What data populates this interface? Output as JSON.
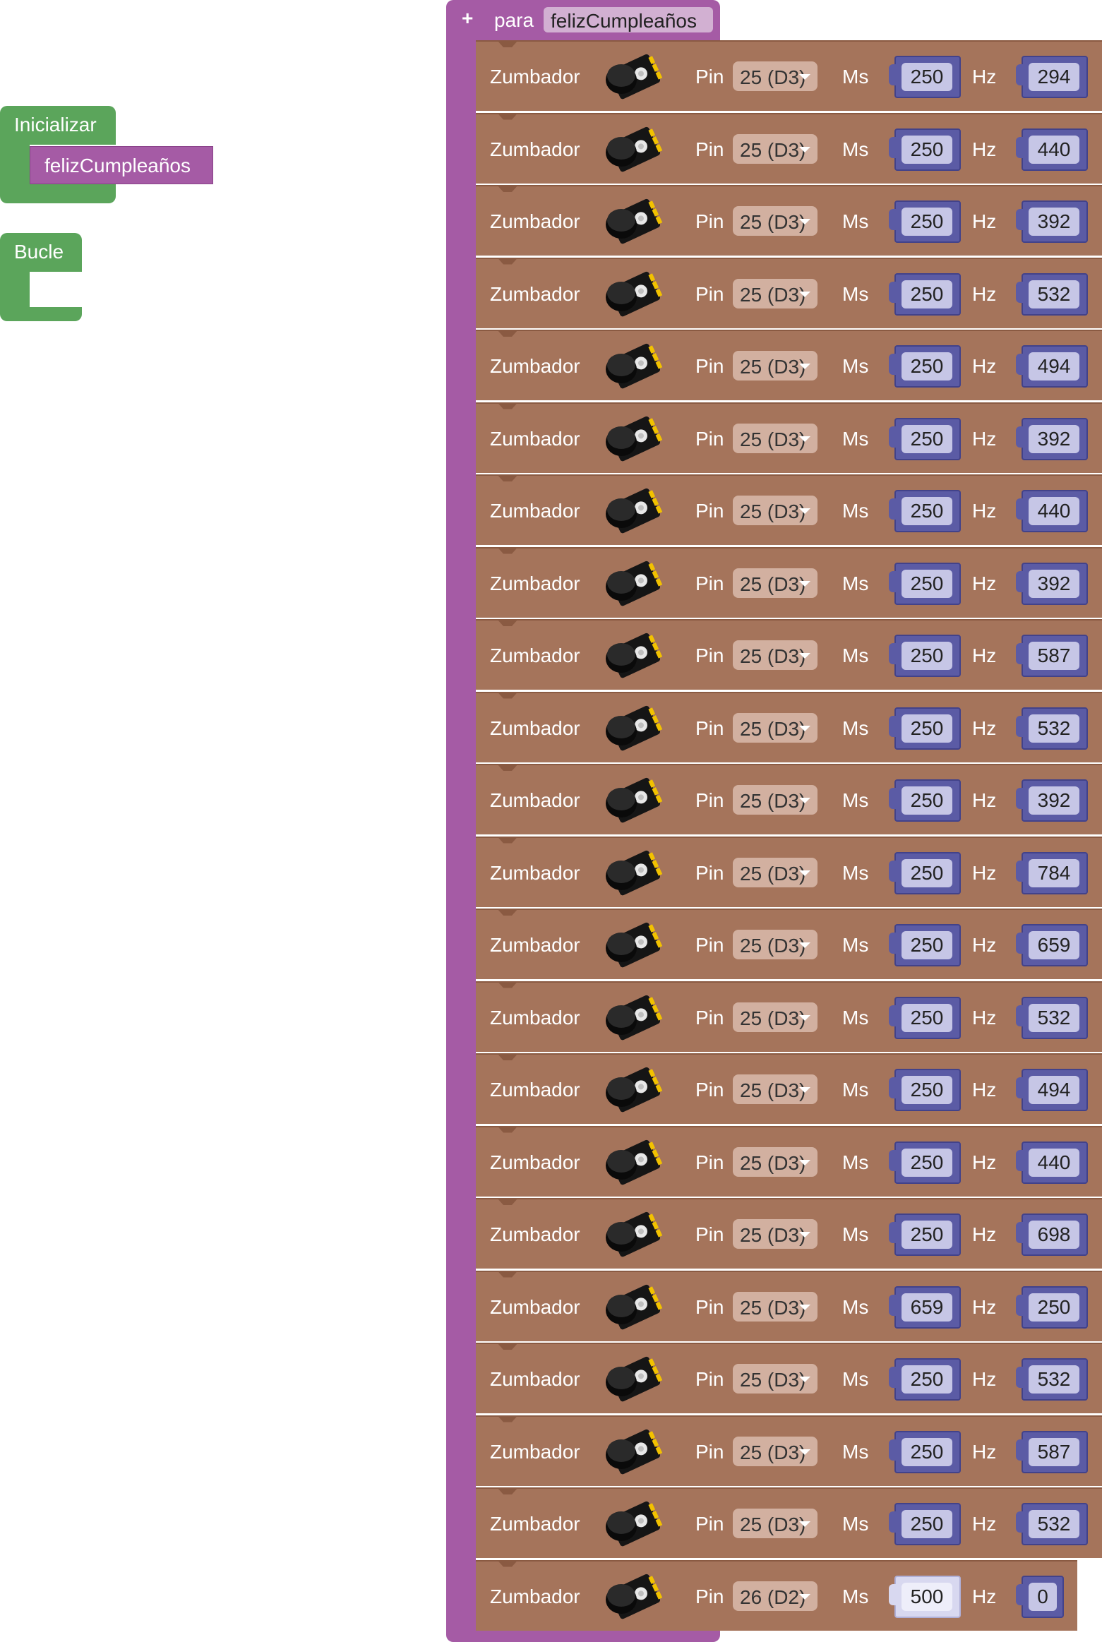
{
  "event_blocks": {
    "init_label": "Inicializar",
    "init_call": "felizCumpleaños",
    "loop_label": "Bucle"
  },
  "function_block": {
    "plus_icon": "+",
    "keyword": "para",
    "name": "felizCumpleaños"
  },
  "buzzer_rows": [
    {
      "label": "Zumbador",
      "pin_label": "Pin",
      "pin": "25 (D3)",
      "ms_label": "Ms",
      "ms": "250",
      "hz_label": "Hz",
      "hz": "294"
    },
    {
      "label": "Zumbador",
      "pin_label": "Pin",
      "pin": "25 (D3)",
      "ms_label": "Ms",
      "ms": "250",
      "hz_label": "Hz",
      "hz": "440"
    },
    {
      "label": "Zumbador",
      "pin_label": "Pin",
      "pin": "25 (D3)",
      "ms_label": "Ms",
      "ms": "250",
      "hz_label": "Hz",
      "hz": "392"
    },
    {
      "label": "Zumbador",
      "pin_label": "Pin",
      "pin": "25 (D3)",
      "ms_label": "Ms",
      "ms": "250",
      "hz_label": "Hz",
      "hz": "532"
    },
    {
      "label": "Zumbador",
      "pin_label": "Pin",
      "pin": "25 (D3)",
      "ms_label": "Ms",
      "ms": "250",
      "hz_label": "Hz",
      "hz": "494"
    },
    {
      "label": "Zumbador",
      "pin_label": "Pin",
      "pin": "25 (D3)",
      "ms_label": "Ms",
      "ms": "250",
      "hz_label": "Hz",
      "hz": "392"
    },
    {
      "label": "Zumbador",
      "pin_label": "Pin",
      "pin": "25 (D3)",
      "ms_label": "Ms",
      "ms": "250",
      "hz_label": "Hz",
      "hz": "440"
    },
    {
      "label": "Zumbador",
      "pin_label": "Pin",
      "pin": "25 (D3)",
      "ms_label": "Ms",
      "ms": "250",
      "hz_label": "Hz",
      "hz": "392"
    },
    {
      "label": "Zumbador",
      "pin_label": "Pin",
      "pin": "25 (D3)",
      "ms_label": "Ms",
      "ms": "250",
      "hz_label": "Hz",
      "hz": "587"
    },
    {
      "label": "Zumbador",
      "pin_label": "Pin",
      "pin": "25 (D3)",
      "ms_label": "Ms",
      "ms": "250",
      "hz_label": "Hz",
      "hz": "532"
    },
    {
      "label": "Zumbador",
      "pin_label": "Pin",
      "pin": "25 (D3)",
      "ms_label": "Ms",
      "ms": "250",
      "hz_label": "Hz",
      "hz": "392"
    },
    {
      "label": "Zumbador",
      "pin_label": "Pin",
      "pin": "25 (D3)",
      "ms_label": "Ms",
      "ms": "250",
      "hz_label": "Hz",
      "hz": "784"
    },
    {
      "label": "Zumbador",
      "pin_label": "Pin",
      "pin": "25 (D3)",
      "ms_label": "Ms",
      "ms": "250",
      "hz_label": "Hz",
      "hz": "659"
    },
    {
      "label": "Zumbador",
      "pin_label": "Pin",
      "pin": "25 (D3)",
      "ms_label": "Ms",
      "ms": "250",
      "hz_label": "Hz",
      "hz": "532"
    },
    {
      "label": "Zumbador",
      "pin_label": "Pin",
      "pin": "25 (D3)",
      "ms_label": "Ms",
      "ms": "250",
      "hz_label": "Hz",
      "hz": "494"
    },
    {
      "label": "Zumbador",
      "pin_label": "Pin",
      "pin": "25 (D3)",
      "ms_label": "Ms",
      "ms": "250",
      "hz_label": "Hz",
      "hz": "440"
    },
    {
      "label": "Zumbador",
      "pin_label": "Pin",
      "pin": "25 (D3)",
      "ms_label": "Ms",
      "ms": "250",
      "hz_label": "Hz",
      "hz": "698"
    },
    {
      "label": "Zumbador",
      "pin_label": "Pin",
      "pin": "25 (D3)",
      "ms_label": "Ms",
      "ms": "659",
      "hz_label": "Hz",
      "hz": "250"
    },
    {
      "label": "Zumbador",
      "pin_label": "Pin",
      "pin": "25 (D3)",
      "ms_label": "Ms",
      "ms": "250",
      "hz_label": "Hz",
      "hz": "532"
    },
    {
      "label": "Zumbador",
      "pin_label": "Pin",
      "pin": "25 (D3)",
      "ms_label": "Ms",
      "ms": "250",
      "hz_label": "Hz",
      "hz": "587"
    },
    {
      "label": "Zumbador",
      "pin_label": "Pin",
      "pin": "25 (D3)",
      "ms_label": "Ms",
      "ms": "250",
      "hz_label": "Hz",
      "hz": "532"
    },
    {
      "label": "Zumbador",
      "pin_label": "Pin",
      "pin": "26 (D2)",
      "ms_label": "Ms",
      "ms": "500",
      "hz_label": "Hz",
      "hz": "0"
    }
  ],
  "colors": {
    "event_green": "#5ba55b",
    "function_purple": "#a55ba5",
    "buzzer_brown": "#a5745b",
    "number_blue": "#5b5ba5"
  },
  "icons": {
    "buzzer": "buzzer-module-icon",
    "dropdown": "chevron-down-icon"
  }
}
